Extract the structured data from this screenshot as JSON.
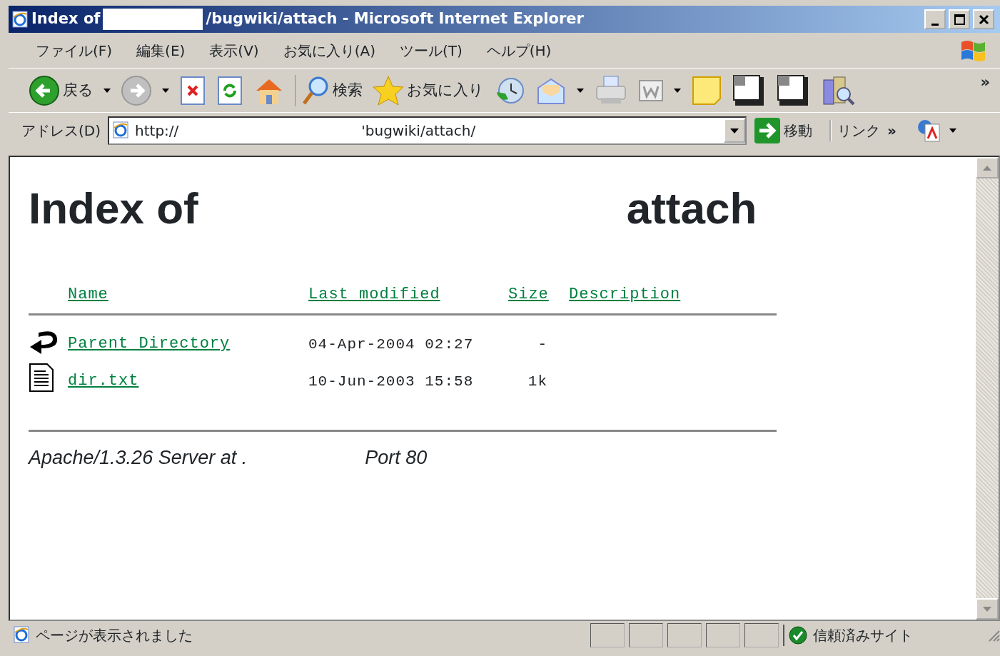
{
  "window": {
    "title_start": "Index of",
    "title_end": "/bugwiki/attach - Microsoft Internet Explorer"
  },
  "menu": [
    "ファイル(F)",
    "編集(E)",
    "表示(V)",
    "お気に入り(A)",
    "ツール(T)",
    "ヘルプ(H)"
  ],
  "toolbar": {
    "back_label": "戻る",
    "search_label": "検索",
    "favorites_label": "お気に入り",
    "overflow": "»"
  },
  "address": {
    "label": "アドレス(D)",
    "url_start": "http://",
    "url_end": "'bugwiki/attach/",
    "go_label": "移動",
    "links_label": "リンク",
    "links_overflow": "»"
  },
  "page": {
    "heading_start": "Index of",
    "heading_end": "attach",
    "columns": [
      "Name",
      "Last modified",
      "Size",
      "Description"
    ],
    "rows": [
      {
        "kind": "parent",
        "name": "Parent Directory",
        "modified": "04-Apr-2004 02:27",
        "size": "-"
      },
      {
        "kind": "file",
        "name": "dir.txt",
        "modified": "10-Jun-2003 15:58",
        "size": "1k"
      }
    ],
    "footer_start": "Apache/1.3.26 Server at .",
    "footer_end": "Port 80"
  },
  "status_bar": {
    "text": "ページが表示されました",
    "zone": "信頼済みサイト"
  }
}
